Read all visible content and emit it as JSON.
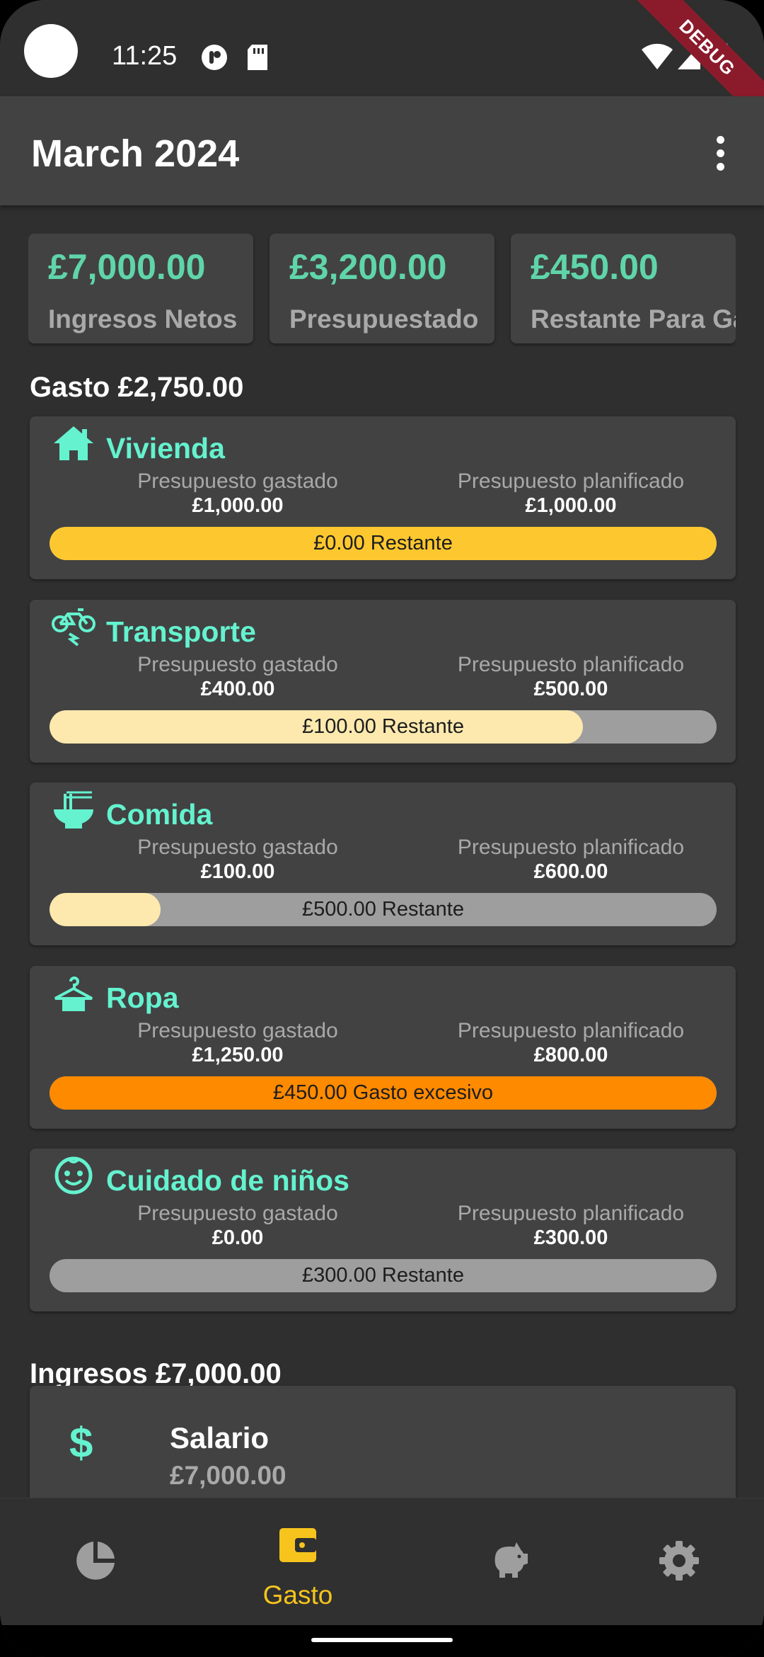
{
  "status_bar": {
    "time": "11:25",
    "debug_banner": "DEBUG"
  },
  "app_bar": {
    "title": "March 2024",
    "more_icon": "more-vert-icon"
  },
  "summary_cards": [
    {
      "amount": "£7,000.00",
      "label": "Ingresos Netos"
    },
    {
      "amount": "£3,200.00",
      "label": "Presupuestado"
    },
    {
      "amount": "£450.00",
      "label": "Restante Para Gastar"
    }
  ],
  "expense_section": {
    "title": "Gasto £2,750.00"
  },
  "categories": [
    {
      "name": "Vivienda",
      "icon": "house-icon",
      "spent_label": "Presupuesto gastado",
      "spent": "£1,000.00",
      "planned_label": "Presupuesto planificado",
      "planned": "£1,000.00",
      "status": "£0.00 Restante",
      "progress": 1.0,
      "fill_color": "#fdc82f",
      "track_color": "#9e9e9e"
    },
    {
      "name": "Transporte",
      "icon": "bicycle-icon",
      "spent_label": "Presupuesto gastado",
      "spent": "£400.00",
      "planned_label": "Presupuesto planificado",
      "planned": "£500.00",
      "status": "£100.00 Restante",
      "progress": 0.8,
      "fill_color": "#fde9ae",
      "track_color": "#9e9e9e"
    },
    {
      "name": "Comida",
      "icon": "noodle-bowl-icon",
      "spent_label": "Presupuesto gastado",
      "spent": "£100.00",
      "planned_label": "Presupuesto planificado",
      "planned": "£600.00",
      "status": "£500.00 Restante",
      "progress": 0.167,
      "fill_color": "#fde9ae",
      "track_color": "#9e9e9e"
    },
    {
      "name": "Ropa",
      "icon": "hanger-shirt-icon",
      "spent_label": "Presupuesto gastado",
      "spent": "£1,250.00",
      "planned_label": "Presupuesto planificado",
      "planned": "£800.00",
      "status": "£450.00 Gasto excesivo",
      "progress": 1.0,
      "fill_color": "#fe8a00",
      "track_color": "#9e9e9e"
    },
    {
      "name": "Cuidado de niños",
      "icon": "child-face-icon",
      "spent_label": "Presupuesto gastado",
      "spent": "£0.00",
      "planned_label": "Presupuesto planificado",
      "planned": "£300.00",
      "status": "£300.00 Restante",
      "progress": 0.0,
      "fill_color": "#fde9ae",
      "track_color": "#9e9e9e"
    }
  ],
  "income_section": {
    "title": "Ingresos £7,000.00"
  },
  "income_items": [
    {
      "name": "Salario",
      "amount": "£7,000.00",
      "icon": "dollar-icon"
    }
  ],
  "bottom_nav": {
    "items": [
      {
        "icon": "pie-chart-icon",
        "label": "",
        "active": false
      },
      {
        "icon": "wallet-icon",
        "label": "Gasto",
        "active": true
      },
      {
        "icon": "piggy-bank-icon",
        "label": "",
        "active": false
      },
      {
        "icon": "gear-icon",
        "label": "",
        "active": false
      }
    ],
    "active_color": "#f6c41d",
    "inactive_color": "#9e9e9e"
  },
  "colors": {
    "accent": "#5fd5a9",
    "category_title": "#64f2cf",
    "background": "#2f2f2f",
    "card": "#424242"
  }
}
